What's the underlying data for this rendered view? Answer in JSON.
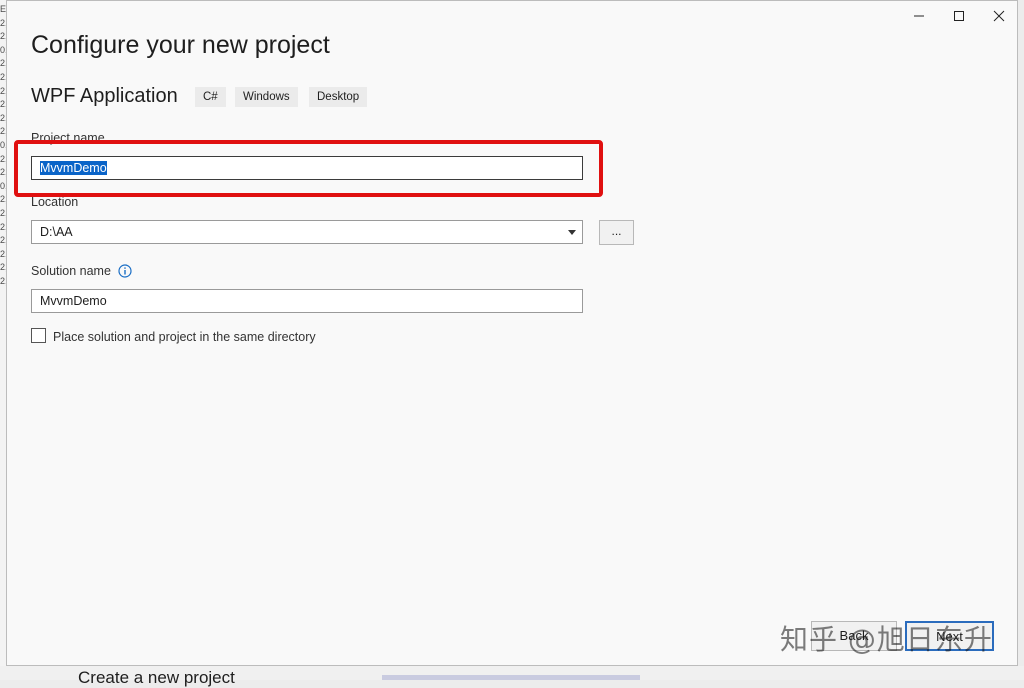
{
  "window": {
    "minimize_icon": "minimize-icon",
    "maximize_icon": "maximize-icon",
    "close_icon": "close-icon"
  },
  "page": {
    "title": "Configure your new project"
  },
  "template": {
    "name": "WPF Application",
    "tags": [
      "C#",
      "Windows",
      "Desktop"
    ]
  },
  "project_name": {
    "label": "Project name",
    "value": "MvvmDemo"
  },
  "location": {
    "label": "Location",
    "value": "D:\\AA",
    "browse_label": "..."
  },
  "solution_name": {
    "label": "Solution name",
    "value": "MvvmDemo",
    "info_icon": "info-icon"
  },
  "same_directory": {
    "label": "Place solution and project in the same directory",
    "checked": false
  },
  "footer": {
    "back_label": "Back",
    "next_label": "Next"
  },
  "background": {
    "behind_title": "Create a new project",
    "left_glyphs": [
      "E",
      "2,",
      "2,",
      "0,",
      "2,",
      "2,",
      "2,",
      "2,",
      "2,",
      "2,",
      "0,",
      "2,",
      "2,",
      "0,",
      "2,",
      "2,",
      "2,",
      "2,",
      "2,",
      "2,",
      "2,"
    ]
  },
  "watermark": {
    "text": "知乎 @旭日东升"
  },
  "accent": {
    "selection": "#0a64c8",
    "highlight": "#e01010"
  }
}
